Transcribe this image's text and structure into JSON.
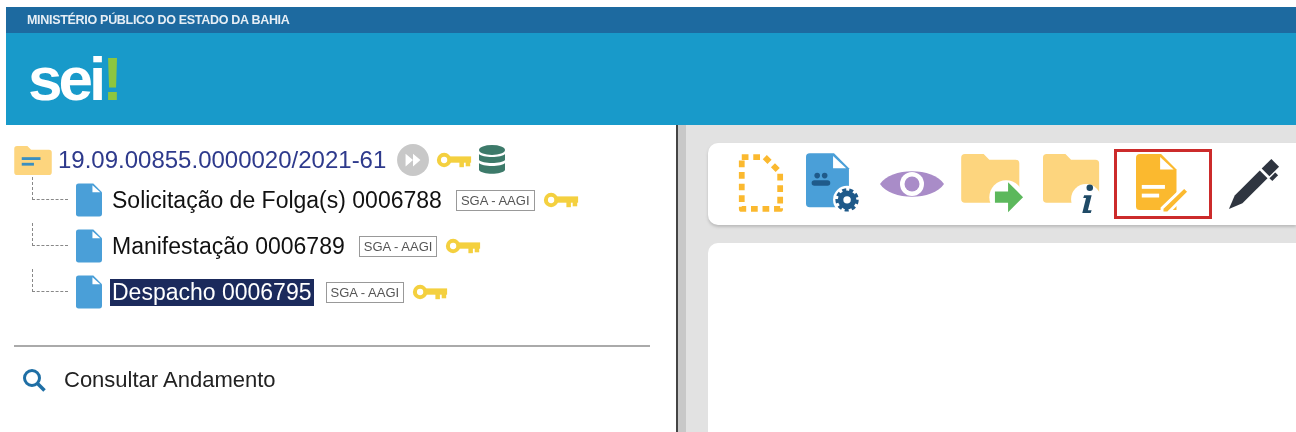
{
  "header": {
    "organization": "MINISTÉRIO PÚBLICO DO ESTADO DA BAHIA",
    "logo": {
      "text": "sei",
      "mark": "!"
    }
  },
  "tree": {
    "process": {
      "label": "19.09.00855.0000020/2021-61",
      "icons": [
        {
          "kind": "forward"
        },
        {
          "kind": "key"
        },
        {
          "kind": "database"
        }
      ]
    },
    "children": [
      {
        "label": "Solicitação de Folga(s) 0006788",
        "unit": "SGA - AAGI",
        "selected": false
      },
      {
        "label": "Manifestação 0006789",
        "unit": "SGA - AAGI",
        "selected": false
      },
      {
        "label": "Despacho 0006795",
        "unit": "SGA - AAGI",
        "selected": true
      }
    ]
  },
  "actions": [
    {
      "label": "Consultar Andamento"
    }
  ],
  "toolbar": [
    {
      "kind": "new-document",
      "highlighted": false
    },
    {
      "kind": "document-settings",
      "highlighted": false
    },
    {
      "kind": "view",
      "highlighted": false
    },
    {
      "kind": "send-folder",
      "highlighted": false
    },
    {
      "kind": "folder-info",
      "highlighted": false
    },
    {
      "kind": "edit-document",
      "highlighted": true
    },
    {
      "kind": "pen",
      "highlighted": false
    }
  ]
}
